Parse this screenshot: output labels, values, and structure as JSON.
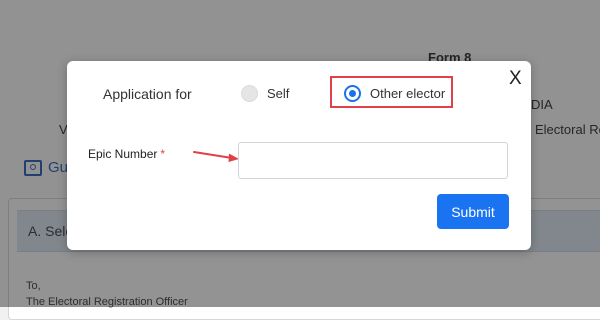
{
  "background": {
    "form_title": "Form 8",
    "dia_fragment": "DIA",
    "v_fragment": "V",
    "electoral_fragment": "Electoral Ro",
    "guide_link": "Gui",
    "section_title": "A. Sele",
    "to_label": "To,",
    "ero_label": "The Electoral Registration Officer"
  },
  "modal": {
    "close_label": "X",
    "application_for_label": "Application for",
    "options": [
      {
        "label": "Self",
        "selected": false
      },
      {
        "label": "Other elector",
        "selected": true
      }
    ],
    "epic_label": "Epic Number",
    "required_marker": "*",
    "epic_value": "",
    "submit_label": "Submit"
  },
  "colors": {
    "accent": "#1a73f0",
    "highlight": "#e04148",
    "required": "#e0424a",
    "overlay": "rgba(40,40,40,0.5)"
  },
  "icons": {
    "guide": "book-eye-icon",
    "annotation": "red-arrow-icon"
  }
}
